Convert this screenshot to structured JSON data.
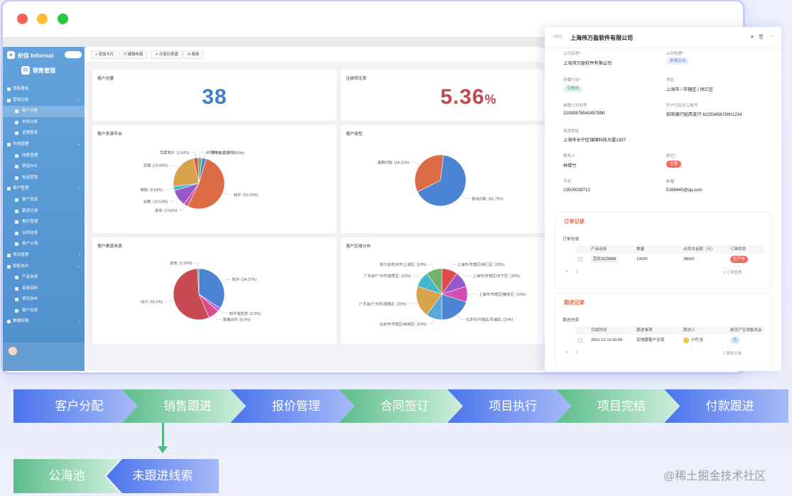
{
  "sidebar": {
    "brand": "织信 Informat",
    "app_title": "销售管理",
    "nav": [
      {
        "label": "销售看板",
        "level": 0
      },
      {
        "label": "营销分析",
        "level": 0,
        "chevron": "⌄"
      },
      {
        "label": "客户分析",
        "level": 1,
        "active": true
      },
      {
        "label": "市场分析",
        "level": 1
      },
      {
        "label": "进度报表",
        "level": 1
      },
      {
        "label": "市场管理",
        "level": 0,
        "chevron": "⌄"
      },
      {
        "label": "线索管理",
        "level": 1
      },
      {
        "label": "渠道ROI",
        "level": 1
      },
      {
        "label": "电话营销",
        "level": 1
      },
      {
        "label": "客户管理",
        "level": 0,
        "chevron": "⌄"
      },
      {
        "label": "客户信息",
        "level": 1
      },
      {
        "label": "跟进记录",
        "level": 1
      },
      {
        "label": "报价管理",
        "level": 1
      },
      {
        "label": "合同信息",
        "level": 1
      },
      {
        "label": "客户公海",
        "level": 1
      },
      {
        "label": "项目管理",
        "level": 0,
        "chevron": "›"
      },
      {
        "label": "销售协作",
        "level": 0,
        "chevron": "⌄"
      },
      {
        "label": "产品信息",
        "level": 1
      },
      {
        "label": "审批资料",
        "level": 1
      },
      {
        "label": "项目协作",
        "level": 1
      },
      {
        "label": "客户信息",
        "level": 1
      },
      {
        "label": "数据权限",
        "level": 0,
        "chevron": "›"
      }
    ]
  },
  "toolbar": {
    "add_card": "+ 添加卡片",
    "edit_layout": "⤧ 编辑布局",
    "share": "↗ 分享仪表盘",
    "refresh": "⟳ 刷新"
  },
  "dashboard": {
    "total_customers": {
      "title": "客户总量",
      "value": "38"
    },
    "conversion": {
      "title": "注册转化率",
      "value": "5.36",
      "unit": "%"
    },
    "source_platform": {
      "title": "客户来源平台"
    },
    "customer_type": {
      "title": "客户类型"
    },
    "industry": {
      "title": "客户渠道来源"
    },
    "region": {
      "title": "客户区域分布"
    }
  },
  "chart_data": [
    {
      "type": "pie",
      "title": "客户来源平台",
      "slices": [
        {
          "label": "知乎",
          "value": 52.63,
          "text": "知乎: (52.63%)",
          "color": "#dd6b46"
        },
        {
          "label": "其他",
          "value": 2.63,
          "text": "其他: (2.63%)",
          "color": "#c9529c"
        },
        {
          "label": "谷歌",
          "value": 10.53,
          "text": "谷歌: (10.53%)",
          "color": "#9858c8"
        },
        {
          "label": "搜狗",
          "value": 2.63,
          "text": "搜狗: (2.63%)",
          "color": "#45b7cf"
        },
        {
          "label": "百度",
          "value": 23.68,
          "text": "百度: (23.68%)",
          "color": "#d8a34a"
        },
        {
          "label": "百度竞价",
          "value": 2.63,
          "text": "百度竞价: (2.63%)",
          "color": "#e24b4b"
        },
        {
          "label": "必应Bing",
          "value": 2.63,
          "text": "必应Bing: (2.63%)",
          "color": "#6fb36a"
        },
        {
          "label": "知乎信息流",
          "value": 2.63,
          "text": "知乎信息流: (2.63%)",
          "color": "#4a84d2"
        }
      ]
    },
    {
      "type": "pie",
      "title": "客户类型",
      "slices": [
        {
          "label": "意向付款",
          "value": 65.79,
          "text": "意向付款: (65.79%)",
          "color": "#4a84d2"
        },
        {
          "label": "周期付款",
          "value": 34.21,
          "text": "周期付款: (34.21%)",
          "color": "#dd6b46"
        }
      ]
    },
    {
      "type": "pie",
      "title": "客户渠道来源",
      "slices": [
        {
          "label": "知乎",
          "value": 34.27,
          "text": "知乎: (34.27%)",
          "color": "#4a84d2"
        },
        {
          "label": "知乎信息流",
          "value": 2.3,
          "text": "知乎信息流: (2.3%)",
          "color": "#c95fd6"
        },
        {
          "label": "直播访问",
          "value": 6.9,
          "text": "直播访问: (6.9%)",
          "color": "#d94d8c"
        },
        {
          "label": "SEO",
          "value": 55.5,
          "text": "SEO: (55.5%)",
          "color": "#c84a52"
        },
        {
          "label": "其他",
          "value": 1.02,
          "text": "其他: (1.02%)",
          "color": "#8a8a8a"
        }
      ]
    },
    {
      "type": "pie",
      "title": "客户区域分布",
      "slices": [
        {
          "label": "上海市/市辖区/徐汇区",
          "value": 10,
          "text": "上海市/市辖区/徐汇区: (10%)",
          "color": "#e24b4b"
        },
        {
          "label": "上海市/市辖区/长宁区",
          "value": 10,
          "text": "上海市/市辖区/长宁区: (10%)",
          "color": "#9858c8"
        },
        {
          "label": "上海市/市辖区/静安区",
          "value": 10,
          "text": "上海市/市辖区/静安区: (10%)",
          "color": "#d04fb4"
        },
        {
          "label": "北京市/市辖区/东城区",
          "value": 20,
          "text": "北京市/市辖区/东城区: (20%)",
          "color": "#4a84d2"
        },
        {
          "label": "北京市/市辖区/西城区",
          "value": 10,
          "text": "北京市/市辖区/西城区: (10%)",
          "color": "#5aa9d6"
        },
        {
          "label": "广东省/广州市/海珠区",
          "value": 20,
          "text": "广东省/广州市/海珠区: (20%)",
          "color": "#d8a34a"
        },
        {
          "label": "广东省/广州市/越秀区",
          "value": 10,
          "text": "广东省/广州市/越秀区: (10%)",
          "color": "#45b7cf"
        },
        {
          "label": "浙江省/杭州市/上城区",
          "value": 10,
          "text": "浙江省/杭州市/上城区: (10%)",
          "color": "#6fb36a"
        }
      ]
    }
  ],
  "panel": {
    "record_id": "#002",
    "company_title": "上海伟万盈软件有限公司",
    "fields": {
      "company_name_label": "公司名称*",
      "company_name": "上海伟万盈软件有限公司",
      "company_type_label": "公司性质*",
      "company_type": "外资企业",
      "industry_label": "所属行业*",
      "industry": "互联网",
      "region_label": "地区",
      "region": "上海市 / 市辖区 / 徐汇区",
      "tax_label": "纳税人识别号",
      "tax": "310908765434578​90",
      "bank_label": "开户行及对公账号",
      "bank": "招商银行延西支行 6225345678901234",
      "address_label": "收货地址",
      "address": "上海市长宁区锦锦科技大厦1307",
      "contact_label": "联系人",
      "contact": "林楼竹",
      "position_label": "职位*",
      "position": "主管",
      "phone_label": "手机",
      "phone": "13500039712",
      "email_label": "邮箱",
      "email": "5189440@qq.com"
    },
    "order": {
      "section": "订单记录",
      "subtitle": "订单信息",
      "cols": [
        "产品信息",
        "数量",
        "合同总金额（元）",
        "订单状态"
      ],
      "row": [
        "芯片GC5608",
        "10000",
        "38000",
        "生产中"
      ],
      "count": "1 订单管理"
    },
    "follow": {
      "section": "跟进记录",
      "subtitle": "跟进信息",
      "cols": [
        "完成时间",
        "跟进事项",
        "跟进人",
        "是否产生销售机会"
      ],
      "row": [
        "2021-12-10 00:00",
        "实地跟客户交流",
        "小叮当",
        "否"
      ],
      "count": "1 跟进记录"
    }
  },
  "flow": {
    "steps": [
      "客户分配",
      "销售跟进",
      "报价管理",
      "合同签订",
      "项目执行",
      "项目完结",
      "付款跟进"
    ],
    "branch": [
      "公海池",
      "未跟进线索"
    ]
  },
  "watermark": "@稀土掘金技术社区",
  "colors": {
    "blue_num": "#3d7fc4",
    "red_num": "#c4474f",
    "sidebar": "#5b9bd5"
  }
}
